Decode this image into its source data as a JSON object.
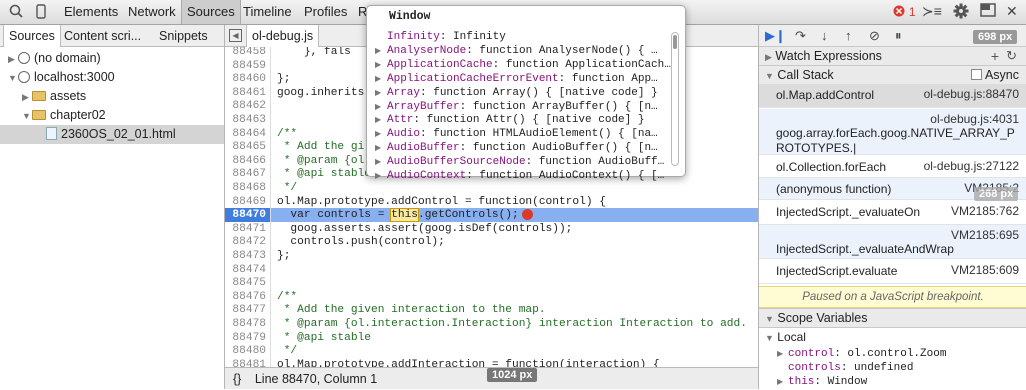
{
  "toolbar": {
    "tabs": [
      "Elements",
      "Network",
      "Sources",
      "Timeline",
      "Profiles",
      "R"
    ],
    "error_count": "1",
    "icons": [
      "search-icon",
      "device-icon",
      "error-icon",
      "console-toggle-icon",
      "gear-icon",
      "dock-icon",
      "close-icon"
    ]
  },
  "navigator": {
    "tabs": [
      "Sources",
      "Content scri...",
      "Snippets"
    ],
    "tree": [
      {
        "label": "(no domain)",
        "kind": "globe",
        "arrow": "▶"
      },
      {
        "label": "localhost:3000",
        "kind": "globe",
        "arrow": "▼"
      },
      {
        "label": "assets",
        "kind": "folder",
        "arrow": "▶"
      },
      {
        "label": "chapter02",
        "kind": "folder",
        "arrow": "▼"
      },
      {
        "label": "2360OS_02_01.html",
        "kind": "file",
        "arrow": ""
      }
    ]
  },
  "editor": {
    "file_tab": "ol-debug.js",
    "current_line": "88470",
    "lines": [
      {
        "n": "88458",
        "t": "    }, fals"
      },
      {
        "n": "88459",
        "t": ""
      },
      {
        "n": "88460",
        "t": "};"
      },
      {
        "n": "88461",
        "t": "goog.inherits"
      },
      {
        "n": "88462",
        "t": ""
      },
      {
        "n": "88463",
        "t": ""
      },
      {
        "n": "88464",
        "t": "/**"
      },
      {
        "n": "88465",
        "t": " * Add the gi"
      },
      {
        "n": "88466",
        "t": " * @param {ol"
      },
      {
        "n": "88467",
        "t": " * @api stable"
      },
      {
        "n": "88468",
        "t": " */"
      },
      {
        "n": "88469",
        "t": "ol.Map.prototype.addControl = function(control) {"
      },
      {
        "n": "88470",
        "t": "  var controls = this.getControls();"
      },
      {
        "n": "88471",
        "t": "  goog.asserts.assert(goog.isDef(controls));"
      },
      {
        "n": "88472",
        "t": "  controls.push(control);"
      },
      {
        "n": "88473",
        "t": "};"
      },
      {
        "n": "88474",
        "t": ""
      },
      {
        "n": "88475",
        "t": ""
      },
      {
        "n": "88476",
        "t": "/**"
      },
      {
        "n": "88477",
        "t": " * Add the given interaction to the map."
      },
      {
        "n": "88478",
        "t": " * @param {ol.interaction.Interaction} interaction Interaction to add."
      },
      {
        "n": "88479",
        "t": " * @api stable"
      },
      {
        "n": "88480",
        "t": " */"
      },
      {
        "n": "88481",
        "t": "ol.Map.prototype.addInteraction = function(interaction) {"
      },
      {
        "n": "88482",
        "t": "  var interactions = this.getInteractions();"
      }
    ],
    "status": "Line 88470, Column 1",
    "status_icon": "{}",
    "width_badge": "1024 px"
  },
  "popover": {
    "title": "Window",
    "rows": [
      {
        "arrow": "",
        "k": "Infinity",
        "v": "Infinity"
      },
      {
        "arrow": "▶",
        "k": "AnalyserNode",
        "v": "function AnalyserNode() { …"
      },
      {
        "arrow": "▶",
        "k": "ApplicationCache",
        "v": "function ApplicationCach…"
      },
      {
        "arrow": "▶",
        "k": "ApplicationCacheErrorEvent",
        "v": "function App…"
      },
      {
        "arrow": "▶",
        "k": "Array",
        "v": "function Array() { [native code] }"
      },
      {
        "arrow": "▶",
        "k": "ArrayBuffer",
        "v": "function ArrayBuffer() { [n…"
      },
      {
        "arrow": "▶",
        "k": "Attr",
        "v": "function Attr() { [native code] }"
      },
      {
        "arrow": "▶",
        "k": "Audio",
        "v": "function HTMLAudioElement() { [na…"
      },
      {
        "arrow": "▶",
        "k": "AudioBuffer",
        "v": "function AudioBuffer() { [n…"
      },
      {
        "arrow": "▶",
        "k": "AudioBufferSourceNode",
        "v": "function AudioBuff…"
      },
      {
        "arrow": "▶",
        "k": "AudioContext",
        "v": "function AudioContext() { […"
      }
    ]
  },
  "sidebar": {
    "width_badge": "698 px",
    "width_badge2": "268 px",
    "watch_label": "Watch Expressions",
    "callstack_label": "Call Stack",
    "async_label": "Async",
    "frames": [
      {
        "fn": "ol.Map.addControl",
        "loc": "ol-debug.js:88470"
      },
      {
        "fn": "goog.array.forEach.goog.NATIVE_ARRAY_PROTOTYPES.|",
        "loc": "ol-debug.js:4031"
      },
      {
        "fn": "ol.Collection.forEach",
        "loc": "ol-debug.js:27122"
      },
      {
        "fn": "(anonymous function)",
        "loc": "VM2185:2"
      },
      {
        "fn": "InjectedScript._evaluateOn",
        "loc": "VM2185:762"
      },
      {
        "fn": "InjectedScript._evaluateAndWrap",
        "loc": "VM2185:695"
      },
      {
        "fn": "InjectedScript.evaluate",
        "loc": "VM2185:609"
      }
    ],
    "paused": "Paused on a JavaScript breakpoint.",
    "scope_label": "Scope Variables",
    "local_label": "Local",
    "scope": [
      {
        "arrow": "▶",
        "k": "control",
        "v": "ol.control.Zoom"
      },
      {
        "arrow": "",
        "k": "controls",
        "v": "undefined"
      },
      {
        "arrow": "▶",
        "k": "this",
        "v": "Window"
      }
    ]
  }
}
